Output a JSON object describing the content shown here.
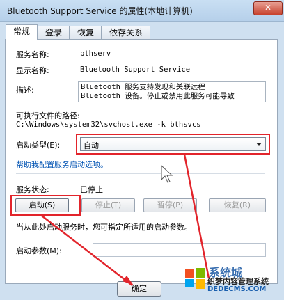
{
  "window": {
    "title": "Bluetooth Support Service 的属性(本地计算机)",
    "close_glyph": "✕"
  },
  "tabs": [
    {
      "label": "常规"
    },
    {
      "label": "登录"
    },
    {
      "label": "恢复"
    },
    {
      "label": "依存关系"
    }
  ],
  "general": {
    "service_name_label": "服务名称:",
    "service_name_value": "bthserv",
    "display_name_label": "显示名称:",
    "display_name_value": "Bluetooth Support Service",
    "description_label": "描述:",
    "description_line1": "Bluetooth 服务支持发现和关联远程",
    "description_line2": "Bluetooth 设备。停止或禁用此服务可能导致",
    "exe_path_label": "可执行文件的路径:",
    "exe_path_value": "C:\\Windows\\system32\\svchost.exe -k bthsvcs",
    "startup_type_label": "启动类型(E):",
    "startup_type_value": "自动",
    "help_link": "帮助我配置服务启动选项。",
    "service_status_label": "服务状态:",
    "service_status_value": "已停止",
    "buttons": {
      "start": "启动(S)",
      "stop": "停止(T)",
      "pause": "暂停(P)",
      "resume": "恢复(R)"
    },
    "hint": "当从此处启动服务时，您可指定所适用的启动参数。",
    "start_params_label": "启动参数(M):",
    "start_params_value": ""
  },
  "footer": {
    "ok_label": "确定"
  },
  "watermark": {
    "title": "系统城",
    "subtitle": "织梦内容管理系统",
    "url": "DEDECMS.COM"
  },
  "colors": {
    "annotation_red": "#e2242b",
    "link_blue": "#0053b3"
  }
}
